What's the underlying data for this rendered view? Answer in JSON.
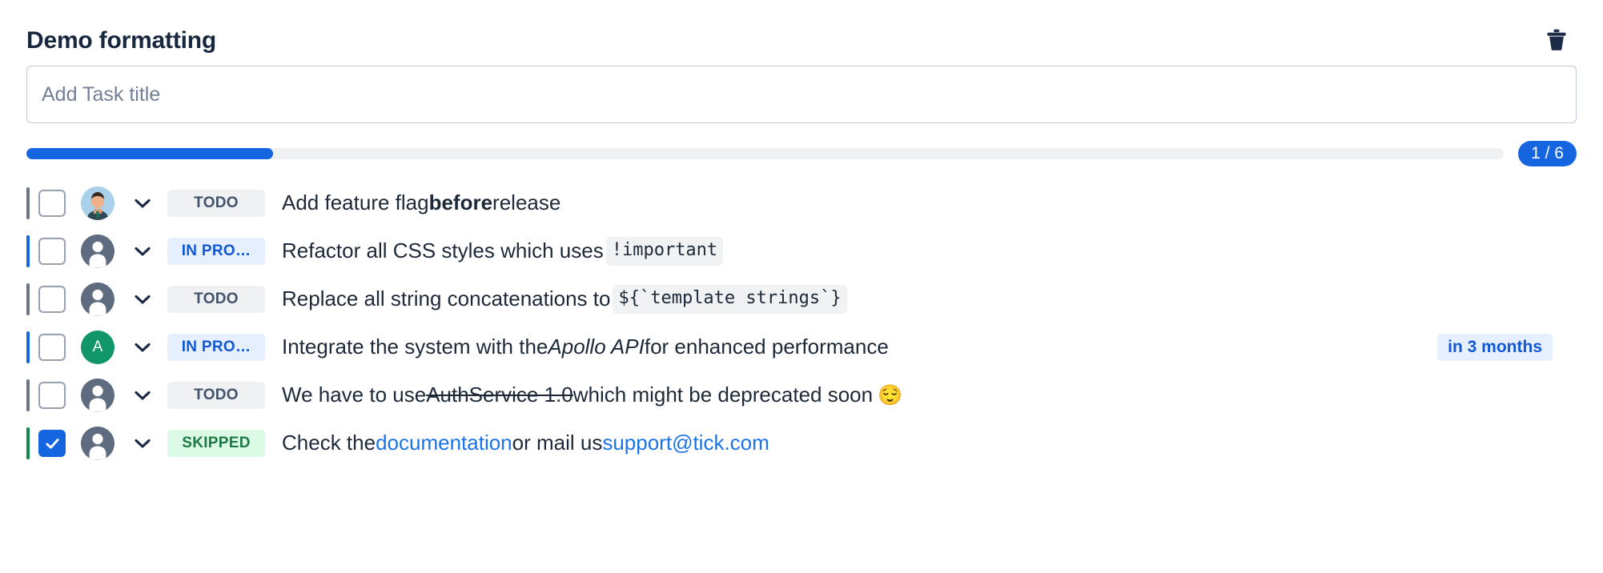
{
  "header": {
    "title": "Demo formatting",
    "delete_icon": "trash-icon"
  },
  "add_task": {
    "placeholder": "Add Task title",
    "value": ""
  },
  "progress": {
    "percent": 16.7,
    "counter": "1 / 6",
    "fill_color": "#1565e0",
    "track_color": "#f0f1f2"
  },
  "colors": {
    "todo_bar": "#6b7684",
    "inprogress_bar": "#1565e0",
    "skipped_bar": "#0f8a4d",
    "link": "#1a73e8",
    "accent": "#1565e0",
    "title": "#17273f"
  },
  "tasks": [
    {
      "checked": false,
      "status": "TODO",
      "status_kind": "todo",
      "bar_color": "#6b7684",
      "avatar_kind": "photo",
      "avatar_label": "",
      "chevron": "chevron-down-icon",
      "due": ""
    },
    {
      "checked": false,
      "status": "IN PRO…",
      "status_kind": "inprogress",
      "bar_color": "#1565e0",
      "avatar_kind": "default",
      "avatar_label": "",
      "chevron": "chevron-down-icon",
      "due": ""
    },
    {
      "checked": false,
      "status": "TODO",
      "status_kind": "todo",
      "bar_color": "#6b7684",
      "avatar_kind": "default",
      "avatar_label": "",
      "chevron": "chevron-down-icon",
      "due": ""
    },
    {
      "checked": false,
      "status": "IN PRO…",
      "status_kind": "inprogress",
      "bar_color": "#1565e0",
      "avatar_kind": "letter",
      "avatar_label": "A",
      "chevron": "chevron-down-icon",
      "due": "in 3 months"
    },
    {
      "checked": false,
      "status": "TODO",
      "status_kind": "todo",
      "bar_color": "#6b7684",
      "avatar_kind": "default",
      "avatar_label": "",
      "chevron": "chevron-down-icon",
      "due": ""
    },
    {
      "checked": true,
      "status": "SKIPPED",
      "status_kind": "skipped",
      "bar_color": "#0f8a4d",
      "avatar_kind": "default",
      "avatar_label": "",
      "chevron": "chevron-down-icon",
      "due": ""
    }
  ],
  "task_text": {
    "t1": {
      "a": "Add feature flag ",
      "bold": "before",
      "b": " release"
    },
    "t2": {
      "a": "Refactor all CSS styles which uses",
      "code": "!important",
      "b": ""
    },
    "t3": {
      "a": "Replace all string concatenations to",
      "code": "${`template strings`}",
      "b": ""
    },
    "t4": {
      "a": "Integrate the system with the ",
      "italic": "Apollo API",
      "b": " for enhanced performance"
    },
    "t5": {
      "a": "We have to use ",
      "strike": "AuthService 1.0",
      "b": " which might be deprecated soon",
      "emoji": "😌"
    },
    "t6": {
      "a": "Check the ",
      "link1": "documentation",
      "b": " or mail us ",
      "link2": "support@tick.com"
    }
  }
}
